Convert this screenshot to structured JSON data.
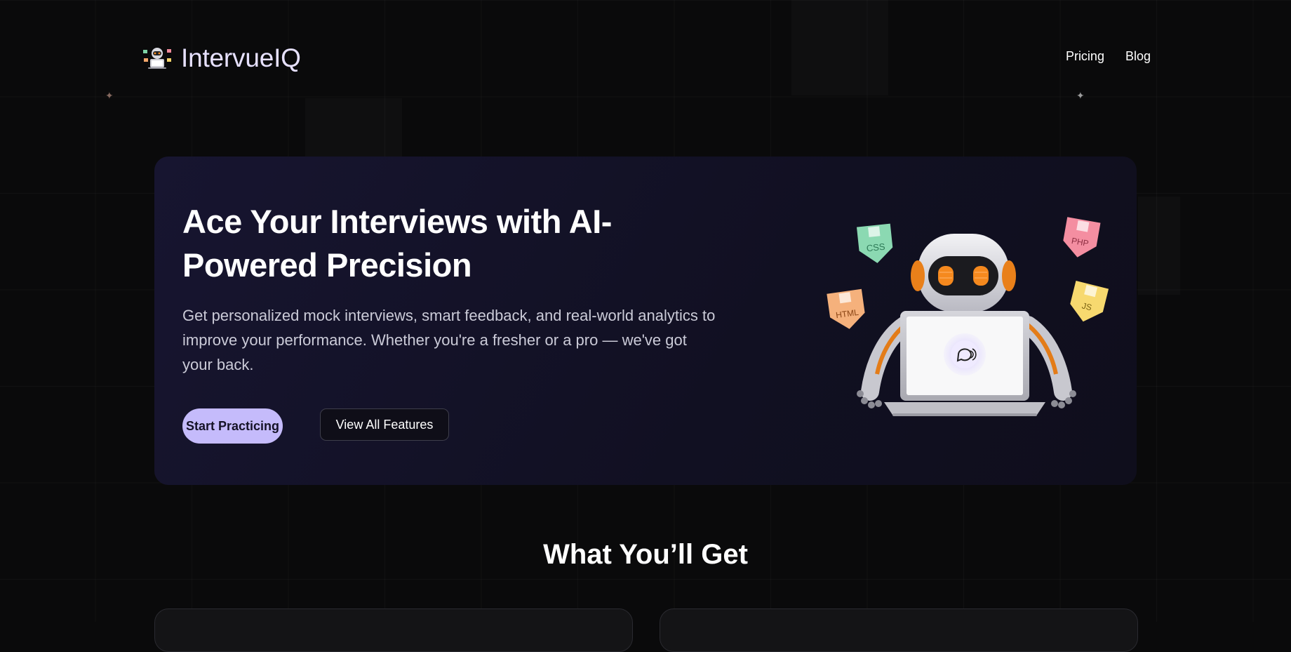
{
  "brand": {
    "name": "IntervueIQ"
  },
  "nav": {
    "links": [
      "Pricing",
      "Blog"
    ]
  },
  "hero": {
    "title": "Ace Your Interviews with AI-Powered Precision",
    "description": "Get personalized mock interviews, smart feedback, and real-world analytics to improve your performance. Whether you're a fresher or a pro — we've got your back.",
    "primary_cta": "Start Practicing",
    "secondary_cta": "View All Features",
    "tags": [
      "CSS",
      "PHP",
      "HTML",
      "JS"
    ]
  },
  "features": {
    "title": "What You’ll Get"
  },
  "colors": {
    "background": "#0a0a0b",
    "hero_bg": "#141228",
    "accent": "#c5bbfb",
    "logo_text": "#e7e1ff"
  }
}
